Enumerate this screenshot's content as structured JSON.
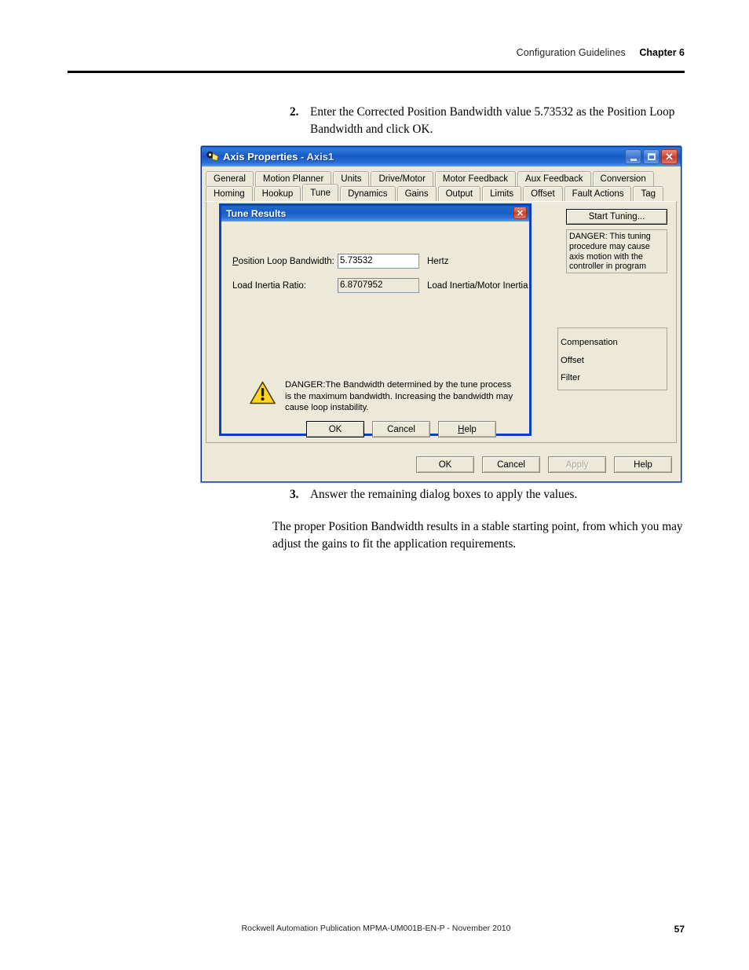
{
  "page": {
    "header_section": "Configuration Guidelines",
    "header_chapter": "Chapter 6",
    "step2_num": "2.",
    "step2_text": "Enter the Corrected Position Bandwidth value 5.73532 as the Position Loop Bandwidth and click OK.",
    "step3_num": "3.",
    "step3_text": "Answer the remaining dialog boxes to apply the values.",
    "paragraph": "The proper Position Bandwidth results in a stable starting point, from which you may adjust the gains to fit the application requirements.",
    "footer_text": "Rockwell Automation Publication MPMA-UM001B-EN-P - November 2010",
    "footer_page": "57"
  },
  "window": {
    "title": "Axis Properties",
    "subtitle": "- Axis1",
    "icon": "axis-gear-icon",
    "titlebar_buttons": {
      "minimize": "minimize-icon",
      "maximize": "maximize-icon",
      "close": "✕"
    },
    "tabs_row1": [
      {
        "label": "General",
        "active": false
      },
      {
        "label": "Motion Planner",
        "active": false
      },
      {
        "label": "Units",
        "active": false
      },
      {
        "label": "Drive/Motor",
        "active": false
      },
      {
        "label": "Motor Feedback",
        "active": false
      },
      {
        "label": "Aux Feedback",
        "active": false
      },
      {
        "label": "Conversion",
        "active": false
      }
    ],
    "tabs_row2": [
      {
        "label": "Homing",
        "active": false
      },
      {
        "label": "Hookup",
        "active": false
      },
      {
        "label": "Tune",
        "active": true
      },
      {
        "label": "Dynamics",
        "active": false
      },
      {
        "label": "Gains",
        "active": false
      },
      {
        "label": "Output",
        "active": false
      },
      {
        "label": "Limits",
        "active": false
      },
      {
        "label": "Offset",
        "active": false
      },
      {
        "label": "Fault Actions",
        "active": false
      },
      {
        "label": "Tag",
        "active": false
      }
    ],
    "tune_panel": {
      "start_tuning_label": "Start Tuning...",
      "danger_text": "DANGER: This tuning procedure may cause axis motion with the controller in program mode.",
      "compensation_group": [
        "Compensation",
        "Offset",
        "Filter"
      ]
    },
    "footer_buttons": [
      {
        "label": "OK",
        "disabled": false
      },
      {
        "label": "Cancel",
        "disabled": false
      },
      {
        "label": "Apply",
        "disabled": true
      },
      {
        "label": "Help",
        "disabled": false
      }
    ]
  },
  "modal": {
    "title": "Tune Results",
    "close_glyph": "✕",
    "fields": [
      {
        "label": "Position Loop Bandwidth:",
        "label_accel": "P",
        "value": "5.73532",
        "unit": "Hertz",
        "readonly": false
      },
      {
        "label": "Load Inertia Ratio:",
        "label_accel": "",
        "value": "6.8707952",
        "unit": "Load Inertia/Motor Inertia",
        "readonly": true
      }
    ],
    "warning_icon": "warning-triangle-icon",
    "warning_text": "DANGER:The Bandwidth determined by the tune process is the maximum bandwidth. Increasing the bandwidth may cause loop instability.",
    "buttons": [
      {
        "label": "OK",
        "default": true
      },
      {
        "label": "Cancel",
        "default": false
      },
      {
        "label": "Help",
        "default": false,
        "accel": "H"
      }
    ]
  },
  "colors": {
    "title_blue": "#1659c4",
    "modal_border": "#0b3fc7",
    "dialog_face": "#ece9d8",
    "warning_yellow": "#ffd520",
    "close_red": "#c8402c"
  }
}
